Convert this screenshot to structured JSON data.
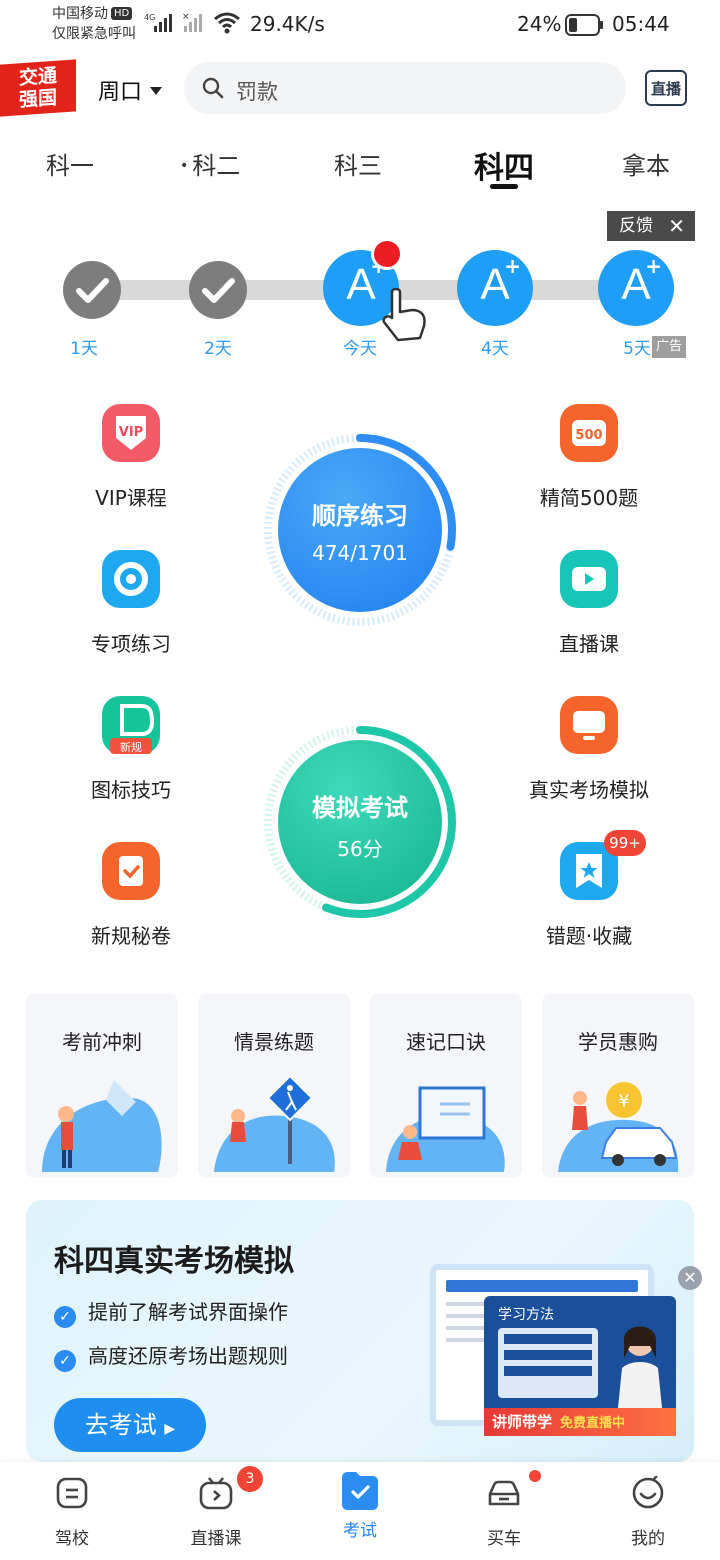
{
  "status_bar": {
    "carrier": "中国移动",
    "hd": "HD",
    "emergency": "仅限紧急呼叫",
    "network": "4G",
    "speed": "29.4K/s",
    "battery": "24%",
    "time": "05:44"
  },
  "header": {
    "logo": "交通强国",
    "logo_line1": "交通",
    "logo_line2": "强国",
    "location": "周口",
    "search_placeholder": "罚款",
    "live_label": "直播"
  },
  "tabs": [
    {
      "label": "科一",
      "active": false
    },
    {
      "label": "科二",
      "active": false
    },
    {
      "label": "科三",
      "active": false
    },
    {
      "label": "科四",
      "active": true
    },
    {
      "label": "拿本",
      "active": false
    }
  ],
  "progress": {
    "days": [
      {
        "label": "1天",
        "state": "done"
      },
      {
        "label": "2天",
        "state": "done"
      },
      {
        "label": "今天",
        "state": "today"
      },
      {
        "label": "4天",
        "state": "future"
      },
      {
        "label": "5天",
        "state": "future"
      }
    ],
    "letter": "A",
    "feedback": "反馈",
    "ad": "广告"
  },
  "grid": {
    "left": [
      {
        "label": "VIP课程",
        "icon": "vip-icon",
        "color": "#f04a5a"
      },
      {
        "label": "专项练习",
        "icon": "target-icon",
        "color": "#1ea8f0"
      },
      {
        "label": "图标技巧",
        "icon": "sign-icon",
        "color": "#16c49a",
        "tag": "新规"
      },
      {
        "label": "新规秘卷",
        "icon": "clipboard-icon",
        "color": "#f5642a"
      }
    ],
    "right": [
      {
        "label": "精简500题",
        "icon": "500-icon",
        "color": "#f5642a",
        "text": "500"
      },
      {
        "label": "直播课",
        "icon": "video-icon",
        "color": "#16c4b8"
      },
      {
        "label": "真实考场模拟",
        "icon": "monitor-icon",
        "color": "#f5642a"
      },
      {
        "label": "错题·收藏",
        "icon": "bookmark-icon",
        "color": "#1ea8f0",
        "badge": "99+"
      }
    ]
  },
  "practice": {
    "title": "顺序练习",
    "progress_text": "474/1701",
    "progress_fraction": 0.279
  },
  "exam": {
    "title": "模拟考试",
    "score": "56分",
    "progress_fraction": 0.56
  },
  "cards": [
    {
      "title": "考前冲刺"
    },
    {
      "title": "情景练题"
    },
    {
      "title": "速记口诀"
    },
    {
      "title": "学员惠购"
    }
  ],
  "banner": {
    "title": "科四真实考场模拟",
    "points": [
      "提前了解考试界面操作",
      "高度还原考场出题规则"
    ],
    "button": "去考试",
    "promo_title": "学习方法",
    "promo_tag": "讲师带学",
    "promo_free": "免费直播中"
  },
  "bottom_nav": [
    {
      "label": "驾校",
      "icon": "school-icon"
    },
    {
      "label": "直播课",
      "icon": "tv-icon",
      "badge": "3"
    },
    {
      "label": "考试",
      "icon": "exam-icon",
      "active": true
    },
    {
      "label": "买车",
      "icon": "car-icon",
      "dot": true
    },
    {
      "label": "我的",
      "icon": "profile-icon"
    }
  ],
  "colors": {
    "accent": "#1e88f0",
    "practice_blue": "#2d8df2",
    "exam_green": "#1dc7a8",
    "badge_red": "#f04436"
  }
}
